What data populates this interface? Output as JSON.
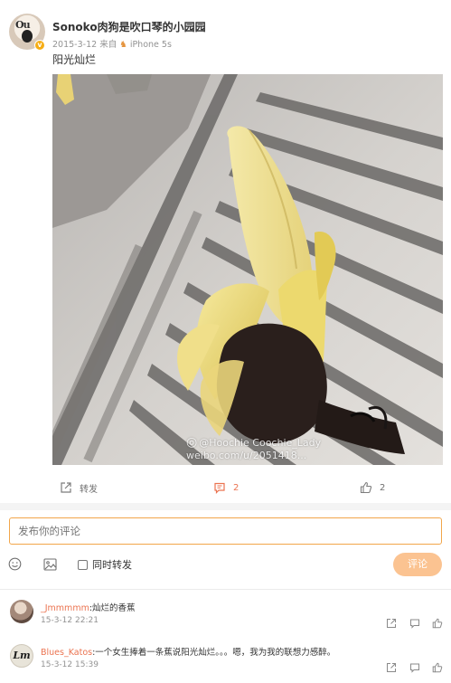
{
  "post": {
    "username": "Sonoko肉狗是吹口琴的小园园",
    "date": "2015-3-12",
    "source_prefix": "来自",
    "source_name": "iPhone 5s",
    "text": "阳光灿烂",
    "avatar_text": "Ou",
    "watermark_line1": "@Hoochie Coochie_Lady",
    "watermark_line2": "weibo.com/u/2051418..."
  },
  "actions": {
    "repost_label": "转发",
    "comment_count": "2",
    "like_count": "2"
  },
  "composer": {
    "placeholder": "发布你的评论",
    "repost_checkbox_label": "同时转发",
    "submit_label": "评论"
  },
  "comments": [
    {
      "user": "_Jmmmmm",
      "text": ":灿烂的香蕉",
      "time": "15-3-12 22:21"
    },
    {
      "user": "Blues_Katos",
      "text": ":一个女生捧着一条蕉说阳光灿烂。。。嗯，我为我的联想力感醉。",
      "time": "15-3-12 15:39",
      "avatar_text": "Lm"
    }
  ],
  "colors": {
    "accent": "#eb7350",
    "composer_border": "#f2a64a",
    "submit_bg": "#fbc391",
    "verified_badge": "#f6ad14"
  }
}
